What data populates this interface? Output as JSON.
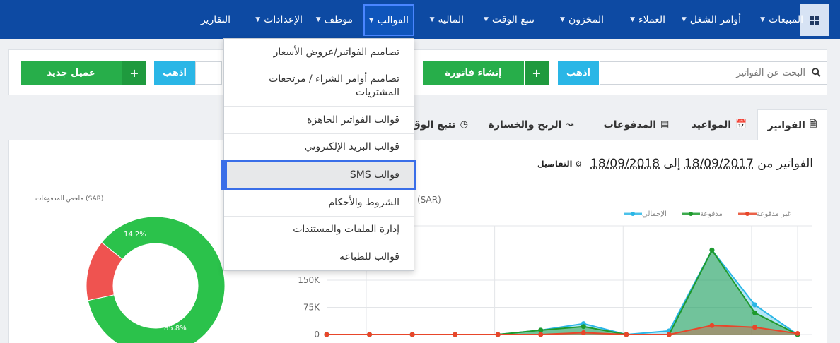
{
  "nav": {
    "items": [
      {
        "label": "المبيعات"
      },
      {
        "label": "أوامر الشغل"
      },
      {
        "label": "العملاء"
      },
      {
        "label": "المخزون"
      },
      {
        "label": "تتبع الوقت"
      },
      {
        "label": "المالية"
      },
      {
        "label": "القوالب"
      },
      {
        "label": "موظف"
      },
      {
        "label": "الإعدادات"
      },
      {
        "label": "التقارير"
      }
    ],
    "active": "القوالب",
    "grid_icon": "grid-icon"
  },
  "actions": {
    "search_placeholder": "البحث عن الفواتير",
    "go_label": "اذهب",
    "create_invoice_label": "إنشاء فاتورة",
    "go_label_2": "اذهب",
    "new_client_label": "عميل جديد"
  },
  "dropdown": {
    "items": [
      {
        "label": "تصاميم الفواتير/عروض الأسعار"
      },
      {
        "label": "تصاميم أوامر الشراء / مرتجعات المشتريات"
      },
      {
        "label": "قوالب الفواتير الجاهزة"
      },
      {
        "label": "قوالب البريد الإلكتروني"
      },
      {
        "label": "قوالب SMS"
      },
      {
        "label": "الشروط والأحكام"
      },
      {
        "label": "إدارة الملفات والمستندات"
      },
      {
        "label": "قوالب للطباعة"
      }
    ],
    "highlighted": "قوالب SMS"
  },
  "tabs": [
    {
      "label": "الفواتير",
      "icon": "file-icon"
    },
    {
      "label": "المواعيد",
      "icon": "calendar-icon"
    },
    {
      "label": "المدفوعات",
      "icon": "credit-card-icon"
    },
    {
      "label": "الربح والخسارة",
      "icon": "line-chart-icon"
    },
    {
      "label": "تتبع الوق",
      "icon": "clock-icon"
    }
  ],
  "report": {
    "title_prefix": "الفواتير من",
    "date_from": "18/09/2017",
    "to_word": "إلى",
    "date_to": "18/09/2018",
    "details_label": "التفاصيل",
    "details_icon": "gear-icon"
  },
  "pie": {
    "caption": "ملخص المدفوعات (SAR)",
    "paid_label": "85.8%",
    "unpaid_label": "14.2%"
  },
  "line_chart": {
    "currency": "(SAR)"
  },
  "chart_data": [
    {
      "type": "pie",
      "title": "ملخص المدفوعات (SAR)",
      "slices": [
        {
          "value": 85.8,
          "color": "#2bc24b"
        },
        {
          "value": 14.2,
          "color": "#ef5350"
        }
      ],
      "donut": true
    },
    {
      "type": "area",
      "ylabel": "(SAR)",
      "y_ticks": [
        "0",
        "75K",
        "150K"
      ],
      "ylim": [
        0,
        300000
      ],
      "x_tick_count": 12,
      "series": [
        {
          "name": "غير مدفوعة",
          "color": "#e8462a",
          "values": [
            0,
            0,
            0,
            0,
            0,
            0,
            5000,
            0,
            0,
            25000,
            20000,
            3000
          ]
        },
        {
          "name": "مدفوعة",
          "color": "#1e9a2c",
          "values": [
            0,
            0,
            0,
            0,
            0,
            12000,
            22000,
            0,
            0,
            233000,
            60000,
            0
          ]
        },
        {
          "name": "الإجمالي",
          "color": "#2ab6e6",
          "values": [
            0,
            0,
            0,
            0,
            0,
            12000,
            30000,
            0,
            10000,
            233000,
            82000,
            0
          ]
        }
      ],
      "legend_position": "top-right",
      "grid": true
    }
  ],
  "colors": {
    "nav_bg": "#0d4aa3",
    "accent_blue": "#2ab6e6",
    "green": "#27ae4a",
    "highlight_border": "#3a6ee8"
  }
}
